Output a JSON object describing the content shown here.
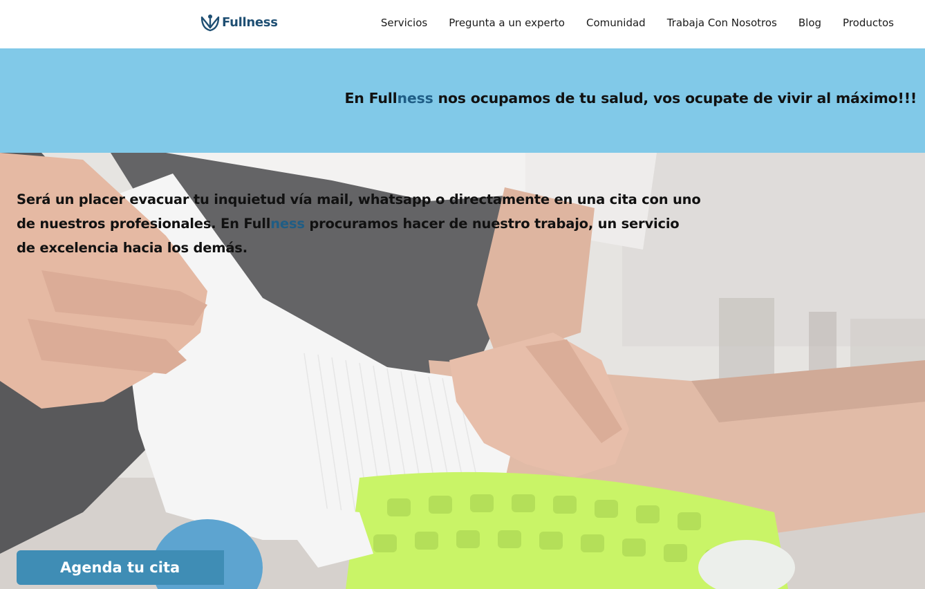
{
  "brand": {
    "name": "Fullness",
    "color": "#1f4f73"
  },
  "nav": {
    "items": [
      {
        "label": "Servicios"
      },
      {
        "label": "Pregunta a un experto"
      },
      {
        "label": "Comunidad"
      },
      {
        "label": "Trabaja Con Nosotros"
      },
      {
        "label": "Blog"
      },
      {
        "label": "Productos"
      }
    ]
  },
  "band": {
    "color": "#81c9e8",
    "tagline": {
      "prefix": "En ",
      "brand_a": "Full",
      "brand_b": "ness",
      "suffix": " nos ocupamos de tu salud, vos ocupate de vivir al máximo!!!"
    }
  },
  "hero": {
    "text_a": "Será un placer evacuar tu inquietud vía mail, whatsapp o directamente en una cita con uno de nuestros profesionales. En ",
    "brand_a": "Full",
    "brand_b": "ness",
    "text_b": " procuramos hacer de nuestro trabajo, un servicio de excelencia hacia los demás.",
    "image_alt": "physiotherapy-photo",
    "cta_label": "Agenda tu cita",
    "cta_color": "#3f8db5"
  },
  "colors": {
    "accent": "#1f5d85"
  }
}
